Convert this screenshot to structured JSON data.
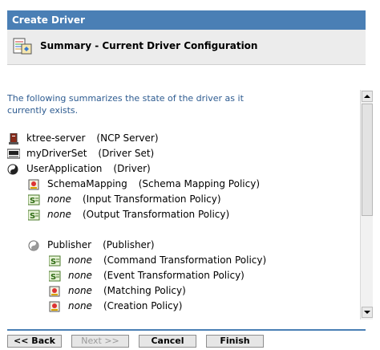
{
  "window": {
    "title": "Create Driver"
  },
  "header": {
    "icon": "configuration-summary-icon",
    "title": "Summary - Current Driver Configuration"
  },
  "intro": "The following summarizes the state of the driver as it currently exists.",
  "tree": [
    {
      "icon": "server-icon",
      "name": "ktree-server",
      "type": "(NCP Server)",
      "italic": false
    },
    {
      "icon": "driver-set-icon",
      "name": "myDriverSet",
      "type": "(Driver Set)",
      "italic": false
    },
    {
      "icon": "driver-icon",
      "name": "UserApplication",
      "type": "(Driver)",
      "italic": false
    },
    {
      "icon": "schema-policy-icon",
      "name": "SchemaMapping",
      "type": "(Schema Mapping Policy)",
      "italic": false
    },
    {
      "icon": "stylesheet-icon",
      "name": "none",
      "type": "(Input Transformation Policy)",
      "italic": true
    },
    {
      "icon": "stylesheet-icon",
      "name": "none",
      "type": "(Output Transformation Policy)",
      "italic": true
    },
    {
      "icon": "publisher-icon",
      "name": "Publisher",
      "type": "(Publisher)",
      "italic": false
    },
    {
      "icon": "stylesheet-icon",
      "name": "none",
      "type": "(Command Transformation Policy)",
      "italic": true
    },
    {
      "icon": "stylesheet-icon",
      "name": "none",
      "type": "(Event Transformation Policy)",
      "italic": true
    },
    {
      "icon": "policy-icon",
      "name": "none",
      "type": "(Matching Policy)",
      "italic": true
    },
    {
      "icon": "policy-icon",
      "name": "none",
      "type": "(Creation Policy)",
      "italic": true
    }
  ],
  "buttons": {
    "back": "<< Back",
    "next": "Next >>",
    "cancel": "Cancel",
    "finish": "Finish"
  },
  "colors": {
    "accent": "#4a7fb5",
    "intro_text": "#2d5b90"
  }
}
